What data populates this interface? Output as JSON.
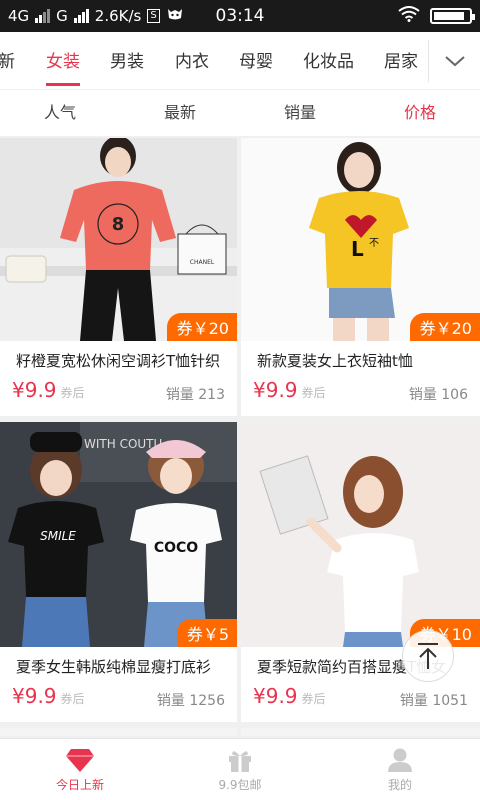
{
  "status_bar": {
    "net1": "4G",
    "net2": "G",
    "speed": "2.6K/s",
    "box": "S",
    "time": "03:14"
  },
  "categories": [
    "新",
    "女装",
    "男装",
    "内衣",
    "母婴",
    "化妆品",
    "居家"
  ],
  "active_category": "女装",
  "sort": [
    "人气",
    "最新",
    "销量",
    "价格"
  ],
  "active_sort": "价格",
  "products": [
    {
      "title": "籽橙夏宽松休闲空调衫T恤针织",
      "price": "¥9.9",
      "price_note": "券后",
      "sales": "销量 213",
      "coupon": "券￥20"
    },
    {
      "title": "新款夏装女上衣短袖t恤",
      "price": "¥9.9",
      "price_note": "券后",
      "sales": "销量 106",
      "coupon": "券￥20"
    },
    {
      "title": "夏季女生韩版纯棉显瘦打底衫",
      "price": "¥9.9",
      "price_note": "券后",
      "sales": "销量 1256",
      "coupon": "券￥5"
    },
    {
      "title": "夏季短款简约百搭显瘦T恤女",
      "price": "¥9.9",
      "price_note": "券后",
      "sales": "销量 1051",
      "coupon": "券￥10"
    }
  ],
  "image_text": {
    "bag_brand": "CHANEL",
    "tee_text_1": "SMILE",
    "tee_text_2": "COCO",
    "store_text": "WITH COUTU"
  },
  "tabs": [
    {
      "label": "今日上新",
      "icon": "diamond-icon"
    },
    {
      "label": "9.9包邮",
      "icon": "gift-icon"
    },
    {
      "label": "我的",
      "icon": "user-icon"
    }
  ],
  "colors": {
    "accent": "#e8344e",
    "coupon": "#ff6a00"
  }
}
